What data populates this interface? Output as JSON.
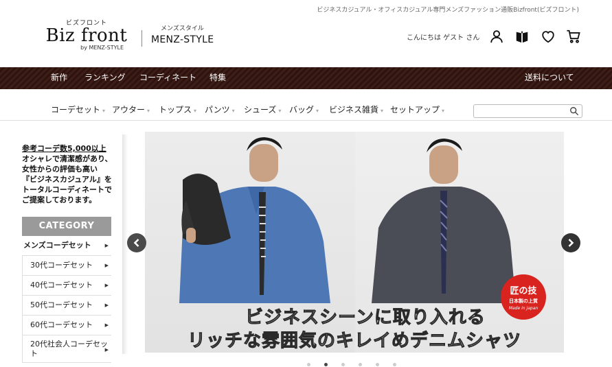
{
  "header": {
    "tagline": "ビジネスカジュアル・オフィスカジュアル専門メンズファッション通販Bizfront(ビズフロント)",
    "logo": {
      "kana": "ビズフロント",
      "name": "Biz front",
      "by": "by MENZ-STYLE"
    },
    "sub_logo": {
      "kana": "メンズスタイル",
      "name": "MENZ-STYLE"
    },
    "greeting": "こんにちは ゲスト さん",
    "icons": [
      "user-icon",
      "bookmark-icon",
      "heart-icon",
      "cart-icon"
    ]
  },
  "navbar": {
    "items": [
      "新作",
      "ランキング",
      "コーディネート",
      "特集"
    ],
    "right": "送料について"
  },
  "catnav": {
    "items": [
      "コーデセット",
      "アウター",
      "トップス",
      "パンツ",
      "シューズ",
      "バッグ",
      "ビジネス雑貨",
      "セットアップ"
    ],
    "search_placeholder": ""
  },
  "sidebar": {
    "intro_link": "参考コーデ数5,000以上",
    "intro_text": [
      "オシャレで清潔感があり、",
      "女性からの評価も高い",
      "『ビジネスカジュアル』を",
      "トータルコーディネートで",
      "ご提案しております。"
    ],
    "category_title": "CATEGORY",
    "categories": [
      {
        "label": "メンズコーデセット",
        "level": "main"
      },
      {
        "label": "30代コーデセット",
        "level": "sub"
      },
      {
        "label": "40代コーデセット",
        "level": "sub"
      },
      {
        "label": "50代コーデセット",
        "level": "sub"
      },
      {
        "label": "60代コーデセット",
        "level": "sub"
      },
      {
        "label": "20代社会人コーデセット",
        "level": "sub"
      }
    ]
  },
  "hero": {
    "caption_line1": "ビジネスシーンに取り入れる",
    "caption_line2": "リッチな雰囲気のキレイめデニムシャツ",
    "badge": {
      "line1": "匠の技",
      "line2": "日本製の上質",
      "line3": "Made in Japan"
    },
    "slide_count": 6,
    "active_slide": 2
  },
  "colors": {
    "navbar": "#3a1a14",
    "category_header": "#9a9a9a",
    "badge": "#d8231f",
    "slider_button": "#4a4a4a"
  }
}
